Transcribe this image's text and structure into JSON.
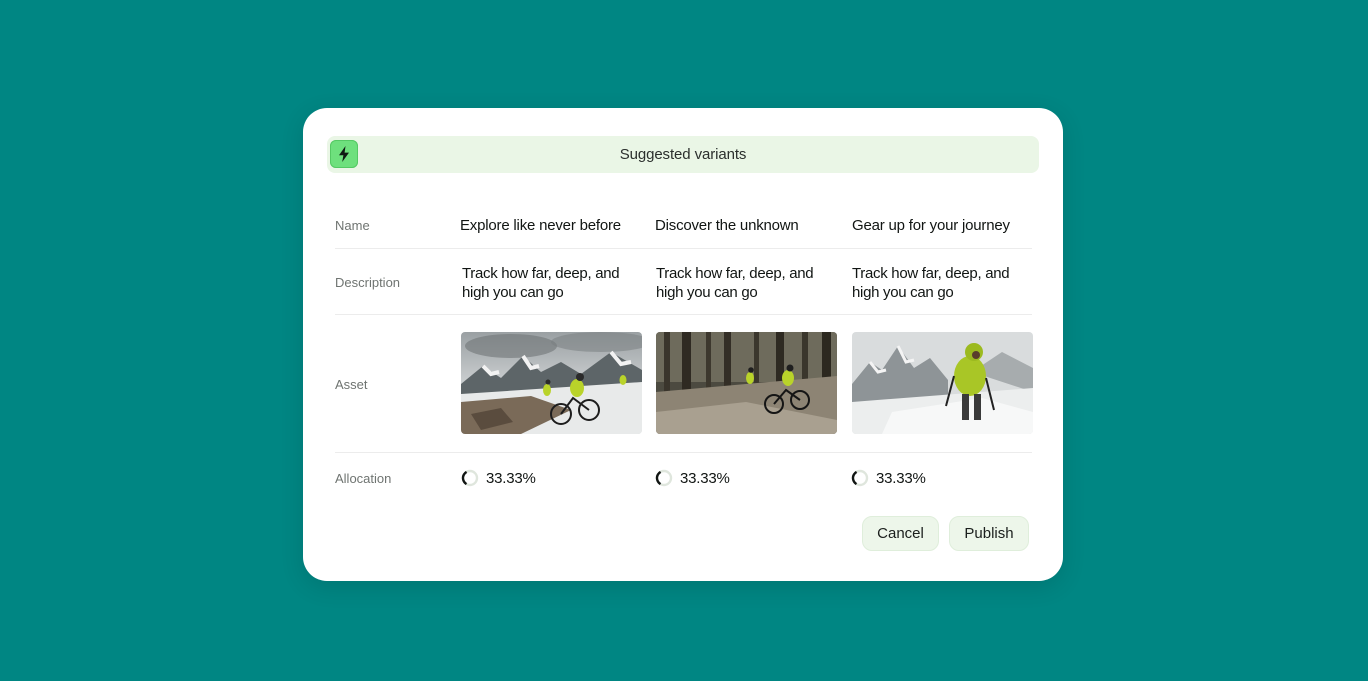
{
  "header": {
    "title": "Suggested variants",
    "icon": "lightning-bolt-icon",
    "accent_color": "#6ee07d"
  },
  "row_labels": {
    "name": "Name",
    "description": "Description",
    "asset": "Asset",
    "allocation": "Allocation"
  },
  "variants": [
    {
      "name": "Explore like never before",
      "description": "Track how far, deep, and high you can go",
      "asset": "mountain-bikers-snowy-peaks-image",
      "allocation": "33.33%",
      "allocation_fraction": 0.3333
    },
    {
      "name": "Discover the unknown",
      "description": "Track how far, deep, and high you can go",
      "asset": "mountain-bikers-forest-image",
      "allocation": "33.33%",
      "allocation_fraction": 0.3333
    },
    {
      "name": "Gear up for your journey",
      "description": "Track how far, deep, and high you can go",
      "asset": "hiker-snowy-mountain-image",
      "allocation": "33.33%",
      "allocation_fraction": 0.3333
    }
  ],
  "actions": {
    "cancel_label": "Cancel",
    "publish_label": "Publish"
  },
  "colors": {
    "background": "#008683",
    "header_bg": "#eaf6e6",
    "button_bg": "#edf6ea"
  }
}
